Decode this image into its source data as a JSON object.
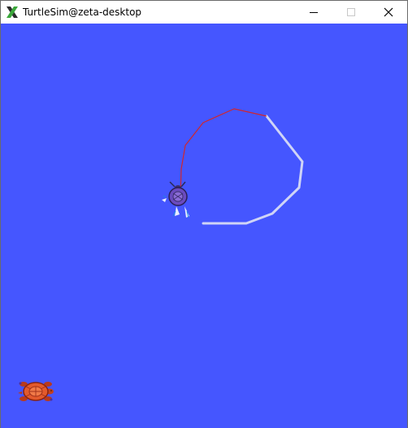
{
  "window": {
    "title": "TurtleSim@zeta-desktop",
    "app_icon": "x-logo-icon",
    "controls": [
      "minimize-icon",
      "maximize-icon",
      "close-icon"
    ]
  },
  "canvas": {
    "background_color": "#4556ff",
    "trails": [
      {
        "name": "red-trail",
        "color": "#d0262d"
      },
      {
        "name": "light-trail",
        "color": "#cfd4f6"
      }
    ],
    "turtles": [
      {
        "icon": "turtle-purple-icon",
        "color": "#6b4bbf"
      },
      {
        "icon": "turtle-orange-icon",
        "color": "#e35a2c"
      }
    ]
  }
}
